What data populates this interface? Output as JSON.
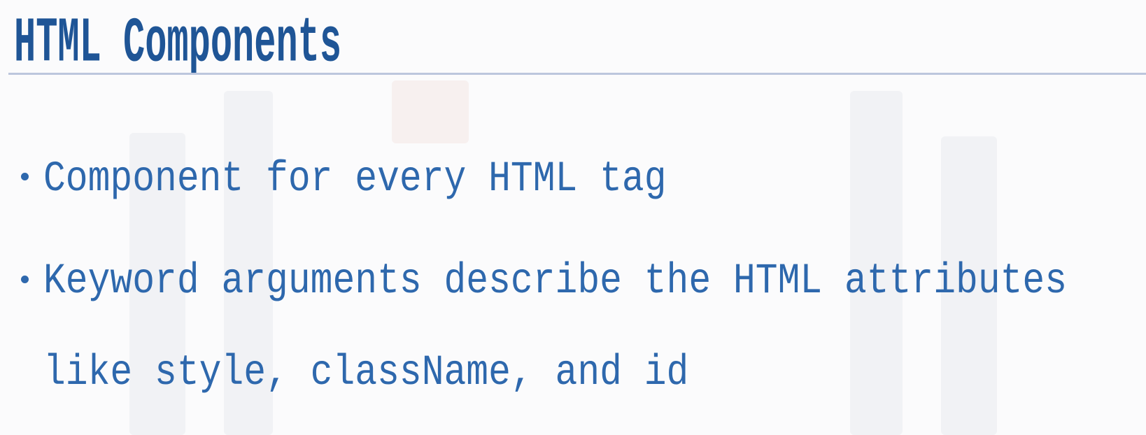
{
  "slide": {
    "title": "HTML Components",
    "bullets": [
      {
        "lines": [
          "Component for every HTML tag"
        ]
      },
      {
        "lines": [
          "Keyword arguments describe the HTML attributes",
          "like style, className, and id"
        ]
      }
    ]
  },
  "colors": {
    "title": "#1f5596",
    "text": "#2e68ad",
    "rule": "#bcc6dd"
  }
}
